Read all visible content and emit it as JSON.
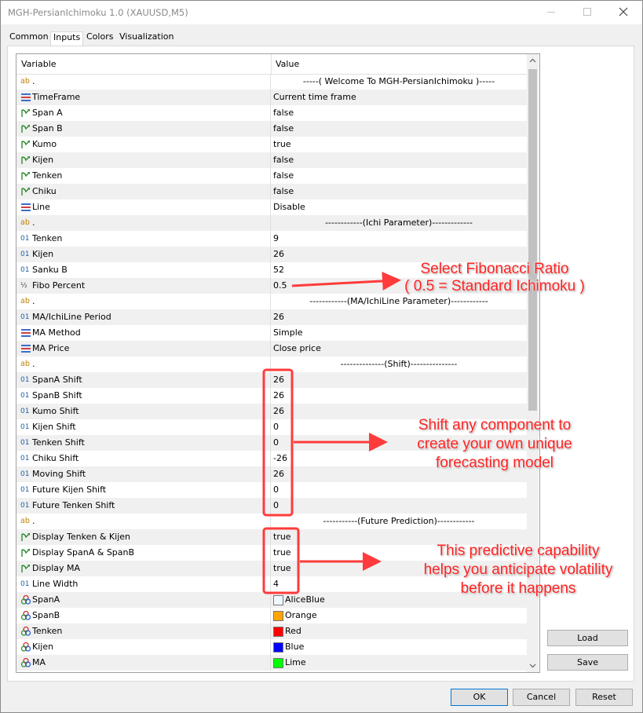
{
  "window": {
    "title": "MGH-PersianIchimoku 1.0 (XAUUSD,M5)"
  },
  "tabs": [
    {
      "label": "Common"
    },
    {
      "label": "Inputs",
      "active": true
    },
    {
      "label": "Colors"
    },
    {
      "label": "Visualization"
    }
  ],
  "grid": {
    "headers": {
      "variable": "Variable",
      "value": "Value"
    },
    "rows": [
      {
        "icon": "ab",
        "name": ".",
        "value": "-----( Welcome To MGH-PersianIchimoku )-----",
        "center": true
      },
      {
        "icon": "enum",
        "name": "TimeFrame",
        "value": "Current time frame"
      },
      {
        "icon": "bool",
        "name": "Span A",
        "value": "false"
      },
      {
        "icon": "bool",
        "name": "Span B",
        "value": "false"
      },
      {
        "icon": "bool",
        "name": "Kumo",
        "value": "true"
      },
      {
        "icon": "bool",
        "name": "Kijen",
        "value": "false"
      },
      {
        "icon": "bool",
        "name": "Tenken",
        "value": "false"
      },
      {
        "icon": "bool",
        "name": "Chiku",
        "value": "false"
      },
      {
        "icon": "enum",
        "name": "Line",
        "value": "Disable"
      },
      {
        "icon": "ab",
        "name": ".",
        "value": "------------(Ichi Parameter)-------------",
        "center": true
      },
      {
        "icon": "int",
        "name": "Tenken",
        "value": "9"
      },
      {
        "icon": "int",
        "name": "Kijen",
        "value": "26"
      },
      {
        "icon": "int",
        "name": "Sanku B",
        "value": "52"
      },
      {
        "icon": "double",
        "name": "Fibo Percent",
        "value": "0.5"
      },
      {
        "icon": "ab",
        "name": ".",
        "value": "------------(MA/IchiLine Parameter)------------",
        "center": true
      },
      {
        "icon": "int",
        "name": "MA/IchiLine Period",
        "value": "26"
      },
      {
        "icon": "enum",
        "name": "MA Method",
        "value": "Simple"
      },
      {
        "icon": "enum",
        "name": "MA Price",
        "value": "Close price"
      },
      {
        "icon": "ab",
        "name": ".",
        "value": "--------------(Shift)---------------",
        "center": true
      },
      {
        "icon": "int",
        "name": "SpanA Shift",
        "value": "26"
      },
      {
        "icon": "int",
        "name": "SpanB Shift",
        "value": "26"
      },
      {
        "icon": "int",
        "name": "Kumo Shift",
        "value": "26"
      },
      {
        "icon": "int",
        "name": "Kijen Shift",
        "value": "0"
      },
      {
        "icon": "int",
        "name": "Tenken Shift",
        "value": "0"
      },
      {
        "icon": "int",
        "name": "Chiku Shift",
        "value": "-26"
      },
      {
        "icon": "int",
        "name": "Moving Shift",
        "value": "26"
      },
      {
        "icon": "int",
        "name": "Future Kijen Shift",
        "value": "0"
      },
      {
        "icon": "int",
        "name": "Future Tenken Shift",
        "value": "0"
      },
      {
        "icon": "ab",
        "name": ".",
        "value": "-----------(Future Prediction)------------",
        "center": true
      },
      {
        "icon": "bool",
        "name": "Display Tenken & Kijen",
        "value": "true"
      },
      {
        "icon": "bool",
        "name": "Display SpanA & SpanB",
        "value": "true"
      },
      {
        "icon": "bool",
        "name": "Display MA",
        "value": "true"
      },
      {
        "icon": "int",
        "name": "Line Width",
        "value": "4"
      },
      {
        "icon": "color",
        "name": "SpanA",
        "value": "AliceBlue",
        "swatch": "#f0f8ff"
      },
      {
        "icon": "color",
        "name": "SpanB",
        "value": "Orange",
        "swatch": "#ffa500"
      },
      {
        "icon": "color",
        "name": "Tenken",
        "value": "Red",
        "swatch": "#ff0000"
      },
      {
        "icon": "color",
        "name": "Kijen",
        "value": "Blue",
        "swatch": "#0000ff"
      },
      {
        "icon": "color",
        "name": "MA",
        "value": "Lime",
        "swatch": "#00ff00"
      }
    ]
  },
  "buttons": {
    "load": "Load",
    "save": "Save",
    "ok": "OK",
    "cancel": "Cancel",
    "reset": "Reset"
  },
  "annotations": {
    "fibo": [
      "Select Fibonacci Ratio",
      "( 0.5 = Standard Ichimoku )"
    ],
    "shift": [
      "Shift any component to",
      "create your own unique",
      "forecasting model"
    ],
    "predict": [
      "This predictive capability",
      "helps you anticipate volatility",
      "before it happens"
    ]
  },
  "colors": {
    "annotation": "#ff2222",
    "accent": "#0078d7"
  }
}
